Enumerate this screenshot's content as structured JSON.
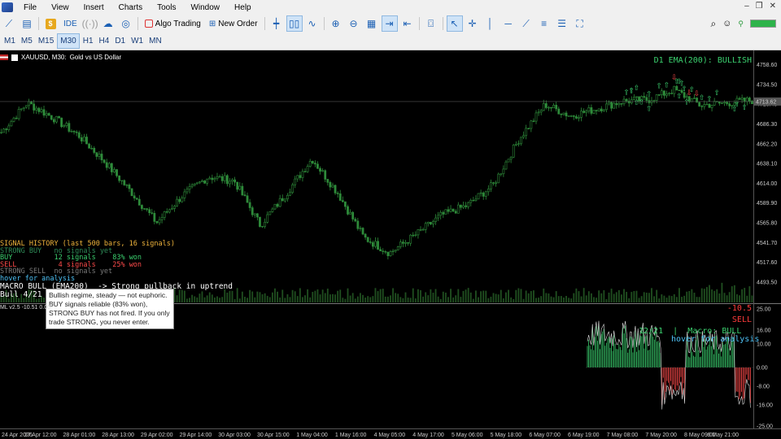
{
  "menu": [
    "File",
    "View",
    "Insert",
    "Charts",
    "Tools",
    "Window",
    "Help"
  ],
  "toolbar": {
    "ide_label": "IDE",
    "algo_label": "Algo Trading",
    "order_label": "New Order"
  },
  "timeframes": [
    "M1",
    "M5",
    "M15",
    "M30",
    "H1",
    "H4",
    "D1",
    "W1",
    "MN"
  ],
  "active_timeframe": "M30",
  "symbol": {
    "name": "XAUUSD, M30:",
    "desc": "Gold vs US Dollar"
  },
  "d1_ema": "D1 EMA(200): BULLISH",
  "price_axis": [
    "4758.60",
    "4734.50",
    "4710.40",
    "4686.30",
    "4662.20",
    "4638.10",
    "4614.00",
    "4589.90",
    "4565.80",
    "4541.70",
    "4517.60",
    "4493.50"
  ],
  "current_price": "4713.62",
  "signal_history": {
    "title": "SIGNAL HISTORY (last 500 bars, 16 signals)",
    "strong_buy": "STRONG BUY   no signals yet",
    "buy_label": "BUY",
    "buy_signals": "12 signals",
    "buy_won": "83% won",
    "sell_label": "SELL",
    "sell_signals": "4 signals",
    "sell_won": "25% won",
    "strong_sell": "STRONG SELL  no signals yet",
    "hover": "hover for analysis"
  },
  "macro_line": "MACRO BULL (EMA200)  -> Strong pullback in uptrend",
  "bull_line": "Bull 4/21",
  "tooltip": "Bullish regime, steady — not euphoric. BUY signals reliable (83% won), STRONG BUY has not fired. If you only trade STRONG, you never enter.",
  "subwindow": {
    "header": "ML v2.5 -10.51 0.00",
    "value": "-10.5",
    "signal": "SELL",
    "info": "12/21  |  Macro: BULL",
    "hover": "hover for analysis",
    "axis": [
      "25.00",
      "16.00",
      "10.00",
      "0.00",
      "-8.00",
      "-16.00",
      "-25.00"
    ]
  },
  "time_axis": [
    "24 Apr 2026",
    "27 Apr 12:00",
    "28 Apr 01:00",
    "28 Apr 13:00",
    "29 Apr 02:00",
    "29 Apr 14:00",
    "30 Apr 03:00",
    "30 Apr 15:00",
    "1 May 04:00",
    "1 May 16:00",
    "4 May 05:00",
    "4 May 17:00",
    "5 May 06:00",
    "5 May 18:00",
    "6 May 07:00",
    "6 May 19:00",
    "7 May 08:00",
    "7 May 20:00",
    "8 May 09:00",
    "8 May 21:00"
  ],
  "colors": {
    "bull": "#3bd16f",
    "bear": "#ff4b4b",
    "candle": "#2e8b3a",
    "amber": "#f0b43c",
    "cyan": "#4fc3f7"
  },
  "chart_data": {
    "type": "line",
    "title": "XAUUSD, M30: Gold vs US Dollar",
    "xlabel": "",
    "ylabel": "",
    "x": [
      "24 Apr 2026",
      "27 Apr 12:00",
      "28 Apr 01:00",
      "28 Apr 13:00",
      "29 Apr 02:00",
      "29 Apr 14:00",
      "30 Apr 03:00",
      "30 Apr 15:00",
      "1 May 04:00",
      "1 May 16:00",
      "4 May 05:00",
      "4 May 17:00",
      "5 May 06:00",
      "5 May 18:00",
      "6 May 07:00",
      "6 May 19:00",
      "7 May 08:00",
      "7 May 20:00",
      "8 May 09:00",
      "8 May 21:00"
    ],
    "series": [
      {
        "values": [
          4676,
          4712,
          4694,
          4672,
          4640,
          4604,
          4566,
          4599,
          4622,
          4617,
          4563,
          4601,
          4644,
          4602,
          4548,
          4529,
          4551,
          4575,
          4587,
          4612,
          4668,
          4710,
          4696,
          4705,
          4714,
          4716,
          4728,
          4709,
          4712,
          4715
        ]
      }
    ],
    "ylim": [
      4493.5,
      4770
    ],
    "grid": false
  }
}
